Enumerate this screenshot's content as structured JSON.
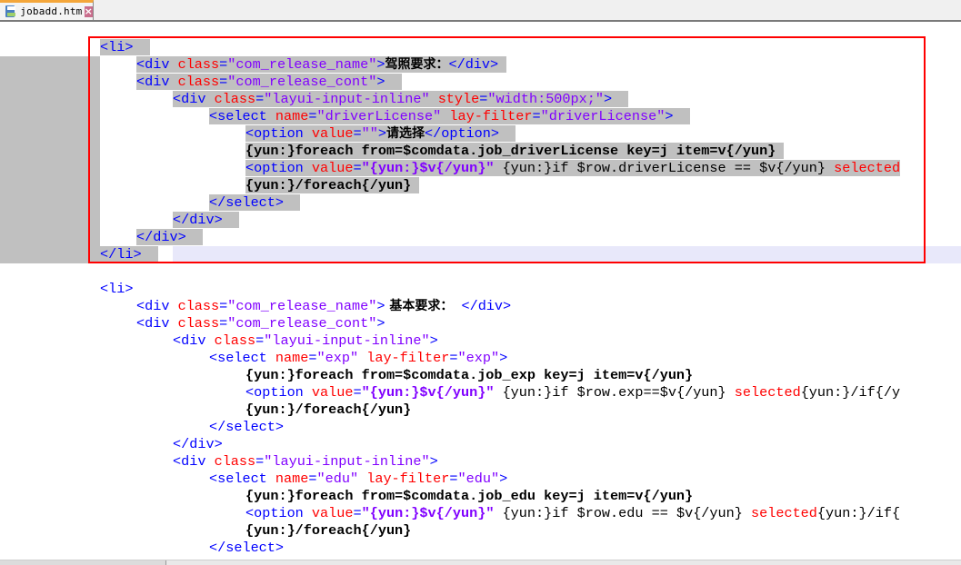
{
  "tab": {
    "filename": "jobadd.htm",
    "icon": "save-icon",
    "close_icon": "close-icon"
  },
  "colors": {
    "tag": "#0000ff",
    "attribute": "#ff0000",
    "attribute_value": "#8000ff",
    "selection": "#c0c0c0",
    "current_line": "#e8e8fa",
    "annotation_box": "#ff0000",
    "tab_accent": "#f4a63a"
  },
  "code": {
    "block1": {
      "l1": "<li>",
      "l2_tag": "<div ",
      "l2_attr": "class",
      "l2_eq": "=",
      "l2_val": "\"com_release_name\"",
      "l2_close": ">",
      "l2_text": "驾照要求：",
      "l2_end": "</div>",
      "l3_tag": "<div ",
      "l3_attr": "class",
      "l3_val": "\"com_release_cont\"",
      "l3_close": ">",
      "l4_tag": "<div ",
      "l4_attr": "class",
      "l4_val": "\"layui-input-inline\"",
      "l4_attr2": "style",
      "l4_val2": "\"width:500px;\"",
      "l4_close": ">",
      "l5_tag": "<select ",
      "l5_attr": "name",
      "l5_val": "\"driverLicense\"",
      "l5_attr2": "lay-filter",
      "l5_val2": "\"driverLicense\"",
      "l5_close": ">",
      "l6_tag": "<option ",
      "l6_attr": "value",
      "l6_val": "\"\"",
      "l6_close": ">",
      "l6_text": "请选择",
      "l6_end": "</option>",
      "l7": "{yun:}foreach from=$comdata.job_driverLicense key=j item=v{/yun}",
      "l8_tag": "<option ",
      "l8_attr": "value",
      "l8_val": "\"{yun:}$v{/yun}\"",
      "l8_rest": " {yun:}if $row.driverLicense == $v{/yun} ",
      "l8_sel": "selected",
      "l9": "{yun:}/foreach{/yun}",
      "l10": "</select>",
      "l11": "</div>",
      "l12": "</div>",
      "l13": "</li>"
    },
    "block2": {
      "l1": "<li>",
      "l2_tag": "<div ",
      "l2_attr": "class",
      "l2_val": "\"com_release_name\"",
      "l2_close": ">",
      "l2_text": " 基本要求：",
      "l2_end": "</div>",
      "l3_tag": "<div ",
      "l3_attr": "class",
      "l3_val": "\"com_release_cont\"",
      "l3_close": ">",
      "l4_tag": "<div ",
      "l4_attr": "class",
      "l4_val": "\"layui-input-inline\"",
      "l4_close": ">",
      "l5_tag": "<select ",
      "l5_attr": "name",
      "l5_val": "\"exp\"",
      "l5_attr2": "lay-filter",
      "l5_val2": "\"exp\"",
      "l5_close": ">",
      "l6": "{yun:}foreach from=$comdata.job_exp key=j item=v{/yun}",
      "l7_tag": "<option ",
      "l7_attr": "value",
      "l7_val": "\"{yun:}$v{/yun}\"",
      "l7_rest": " {yun:}if $row.exp==$v{/yun} ",
      "l7_sel": "selected",
      "l7_tail": "{yun:}/if{/y",
      "l8": "{yun:}/foreach{/yun}",
      "l9": "</select>",
      "l10": "</div>",
      "l11_tag": "<div ",
      "l11_attr": "class",
      "l11_val": "\"layui-input-inline\"",
      "l11_close": ">",
      "l12_tag": "<select ",
      "l12_attr": "name",
      "l12_val": "\"edu\"",
      "l12_attr2": "lay-filter",
      "l12_val2": "\"edu\"",
      "l12_close": ">",
      "l13": "{yun:}foreach from=$comdata.job_edu key=j item=v{/yun}",
      "l14_tag": "<option ",
      "l14_attr": "value",
      "l14_val": "\"{yun:}$v{/yun}\"",
      "l14_rest": " {yun:}if $row.edu == $v{/yun} ",
      "l14_sel": "selected",
      "l14_tail": "{yun:}/if{",
      "l15": "{yun:}/foreach{/yun}",
      "l16": "</select>"
    }
  }
}
